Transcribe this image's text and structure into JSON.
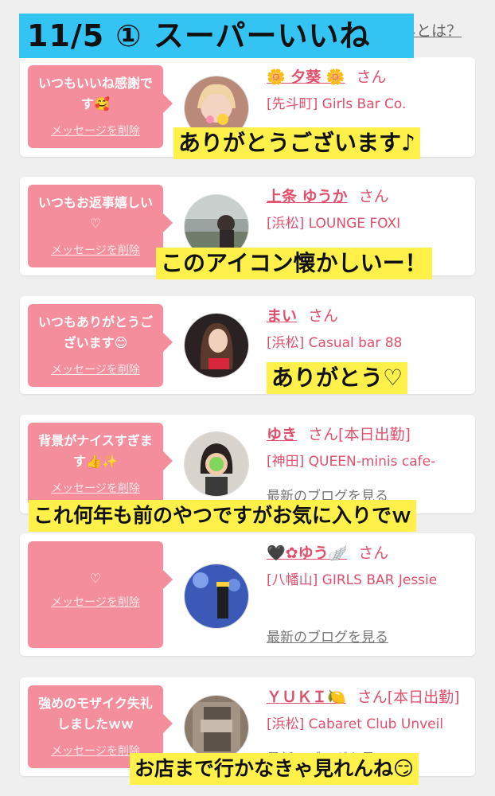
{
  "title": "11/5 ① スーパーいいね",
  "header_link": "ネとは？",
  "cards": [
    {
      "message": "いつもいいね感謝です🥰",
      "delete_label": "メッセージを削除",
      "name": "🌼 夕葵 🌼",
      "san": "さん",
      "status": "",
      "shop": "[先斗町] Girls Bar Co.",
      "blog": ""
    },
    {
      "message": "いつもお返事嬉しい♡",
      "delete_label": "メッセージを削除",
      "name": "上条 ゆうか",
      "san": "さん",
      "status": "",
      "shop": "[浜松] LOUNGE FOXI",
      "blog": ""
    },
    {
      "message": "いつもありがとうございます😊",
      "delete_label": "メッセージを削除",
      "name": "まい",
      "san": "さん",
      "status": "",
      "shop": "[浜松] Casual bar 88",
      "blog": ""
    },
    {
      "message": "背景がナイスすぎます👍✨",
      "delete_label": "メッセージを削除",
      "name": "ゆき",
      "san": "さん",
      "status": "[本日出勤]",
      "shop": "[神田] QUEEN-minis cafe-",
      "blog": "最新のブログを見る"
    },
    {
      "message": "♡",
      "delete_label": "メッセージを削除",
      "name": "🖤✿ゆう🪽",
      "san": "さん",
      "status": "",
      "shop": "[八幡山] GIRLS BAR Jessie",
      "blog": "最新のブログを見る"
    },
    {
      "message": "強めのモザイク失礼しましたｗｗ",
      "delete_label": "メッセージを削除",
      "name": "ＹＵＫＩ🍋",
      "san": "さん",
      "status": "[本日出勤]",
      "shop": "[浜松] Cabaret Club Unveil",
      "blog": "最新のブログを見る"
    }
  ],
  "captions": [
    "ありがとうございます♪",
    "このアイコン懐かしいー！",
    "ありがとう♡",
    "これ何年も前のやつですがお気に入りでｗ",
    "お店まで行かなきゃ見れんね😏"
  ],
  "colors": {
    "accent": "#e04f6c",
    "bubble": "#f48e9c",
    "banner": "#33c4f4",
    "caption": "#fff14a"
  }
}
